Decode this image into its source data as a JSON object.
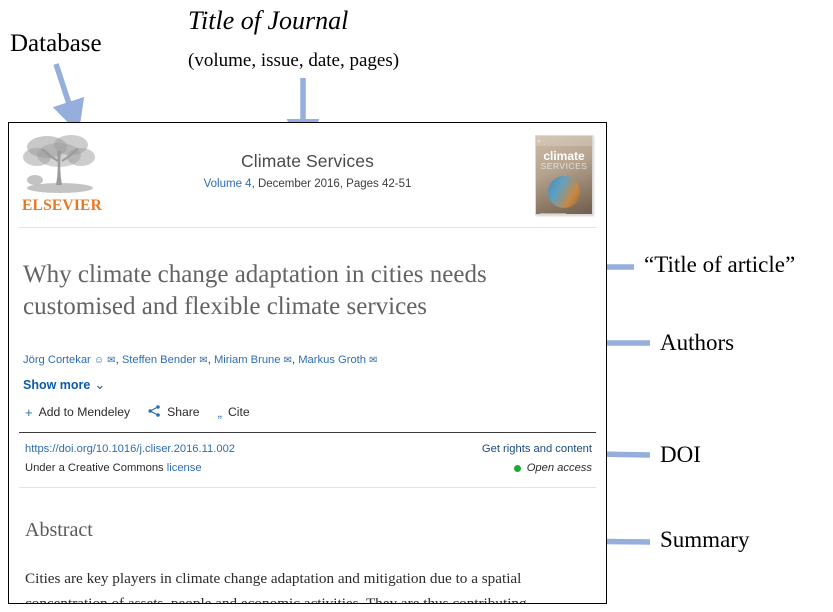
{
  "annotations": {
    "database": "Database",
    "journal_title": "Title of Journal",
    "journal_subtitle": "(volume, issue, date, pages)",
    "article_title": "“Title of article”",
    "authors": "Authors",
    "doi": "DOI",
    "summary": "Summary"
  },
  "arrow_color": "#95AEDC",
  "card": {
    "journal": {
      "publisher_logo_text": "ELSEVIER",
      "name": "Climate Services",
      "volume": "Volume 4",
      "meta_rest": ", December 2016, Pages 42-51",
      "cover": {
        "line1": "climate",
        "line2": "SERVICES"
      }
    },
    "title": "Why climate change adaptation in cities needs customised and flexible climate services",
    "authors": [
      {
        "name": "Jörg Cortekar",
        "icons": [
          "person-icon",
          "envelope-icon"
        ]
      },
      {
        "name": "Steffen Bender",
        "icons": [
          "envelope-icon"
        ]
      },
      {
        "name": "Miriam Brune",
        "icons": [
          "envelope-icon"
        ]
      },
      {
        "name": "Markus Groth",
        "icons": [
          "envelope-icon"
        ]
      }
    ],
    "show_more": "Show more",
    "actions": [
      {
        "label": "Add to Mendeley",
        "icon": "plus-icon"
      },
      {
        "label": "Share",
        "icon": "share-icon"
      },
      {
        "label": "Cite",
        "icon": "quote-icon"
      }
    ],
    "doi_url": "https://doi.org/10.1016/j.cliser.2016.11.002",
    "rights_link": "Get rights and content",
    "license_prefix": "Under a Creative Commons ",
    "license_link": "license",
    "open_access": "Open access",
    "abstract_heading": "Abstract",
    "abstract_text": "Cities are key players in climate change adaptation and mitigation due to a spatial concentration of assets, people and economic activities. They are thus contributing"
  },
  "colors": {
    "link_blue": "#2e6db4",
    "open_access_green": "#1faa36",
    "elsevier_orange": "#E87722"
  }
}
